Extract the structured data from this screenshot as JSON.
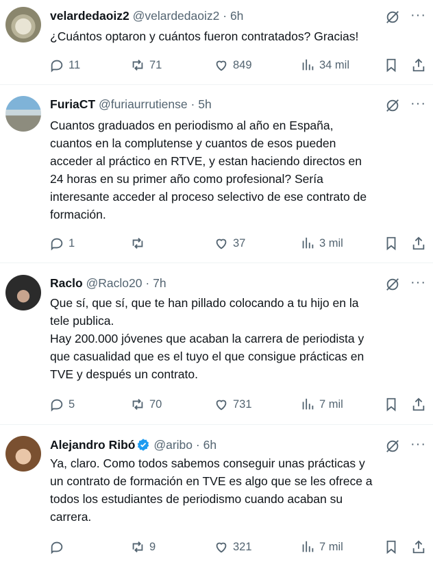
{
  "tweets": [
    {
      "name": "velardedaoiz2",
      "handle": "@velardedaoiz2",
      "sep": "·",
      "time": "6h",
      "text": "¿Cuántos optaron y cuántos fueron contratados? Gracias!",
      "replies": "11",
      "retweets": "71",
      "likes": "849",
      "views": "34 mil",
      "verified": false
    },
    {
      "name": "FuriaCT",
      "handle": "@furiaurrutiense",
      "sep": "·",
      "time": "5h",
      "text": "Cuantos graduados en periodismo al año en España,\ncuantos en la complutense y cuantos de esos pueden\nacceder al práctico en RTVE, y estan haciendo directos en\n24 horas en su primer año como profesional? Sería\ninteresante acceder al proceso selectivo de ese contrato de\nformación.",
      "replies": "1",
      "retweets": "",
      "likes": "37",
      "views": "3 mil",
      "verified": false
    },
    {
      "name": "Raclo",
      "handle": "@Raclo20",
      "sep": "·",
      "time": "7h",
      "text": "Que sí, que sí, que te han pillado colocando a tu hijo en la\ntele publica.\nHay 200.000 jóvenes que acaban la carrera de periodista y\nque casualidad que es el tuyo el que consigue prácticas en\nTVE y después un contrato.",
      "replies": "5",
      "retweets": "70",
      "likes": "731",
      "views": "7 mil",
      "verified": false
    },
    {
      "name": "Alejandro Ribó",
      "handle": "@aribo",
      "sep": "·",
      "time": "6h",
      "text": "Ya, claro. Como todos sabemos conseguir unas prácticas y\nun contrato de formación en TVE es algo que se les ofrece a\ntodos los estudiantes de periodismo cuando acaban su\ncarrera.",
      "replies": "",
      "retweets": "9",
      "likes": "321",
      "views": "7 mil",
      "verified": true
    }
  ],
  "ui": {
    "more": "···",
    "accent": "#1d9bf0",
    "icon_color": "#536471"
  }
}
